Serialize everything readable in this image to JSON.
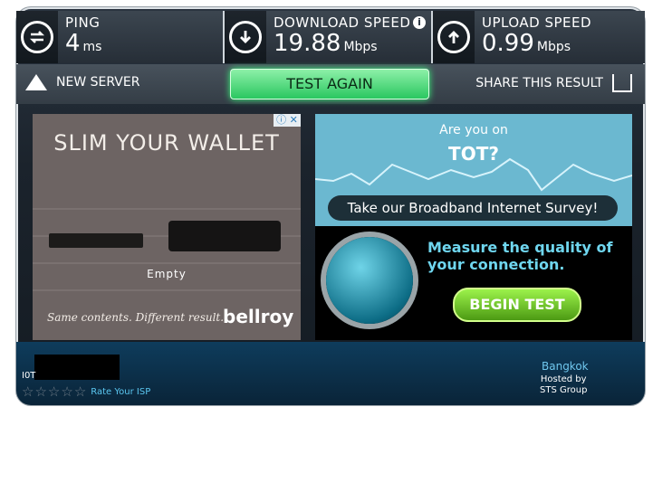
{
  "topbar": {
    "ping": {
      "label": "PING",
      "value": "4",
      "unit": "ms"
    },
    "download": {
      "label": "DOWNLOAD SPEED",
      "value": "19.88",
      "unit": "Mbps"
    },
    "upload": {
      "label": "UPLOAD SPEED",
      "value": "0.99",
      "unit": "Mbps"
    }
  },
  "actions": {
    "new_server": "NEW SERVER",
    "test_again": "TEST AGAIN",
    "share": "SHARE THIS RESULT"
  },
  "ad_left": {
    "headline": "SLIM YOUR WALLET",
    "empty": "Empty",
    "tagline": "Same contents. Different result.",
    "brand": "bellroy"
  },
  "ad_right": {
    "q1": "Are you on",
    "q2": "TOT?",
    "survey_button": "Take our Broadband Internet Survey!",
    "measure": "Measure the quality of your connection.",
    "begin": "BEGIN TEST"
  },
  "isp": {
    "name": "I0T",
    "rate": "Rate Your ISP"
  },
  "server": {
    "city": "Bangkok",
    "host1": "Hosted by",
    "host2": "STS Group"
  },
  "colors": {
    "accent": "#2ac760",
    "panel": "#1b232c",
    "blue": "#6fc7ee"
  }
}
